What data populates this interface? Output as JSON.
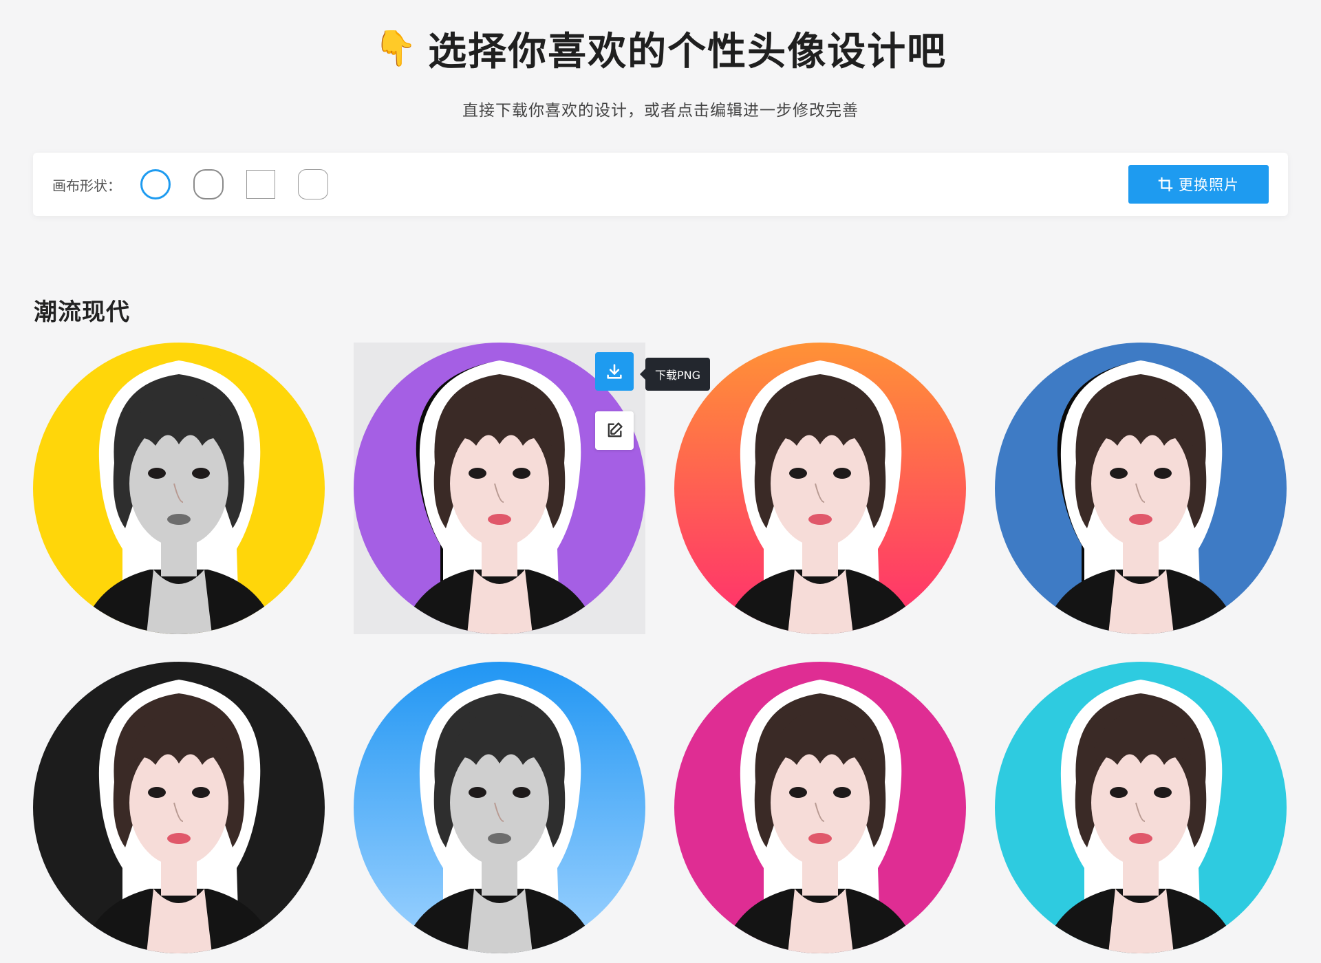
{
  "header": {
    "emoji": "👇",
    "title": "选择你喜欢的个性头像设计吧",
    "subtitle": "直接下载你喜欢的设计，或者点击编辑进一步修改完善"
  },
  "toolbar": {
    "shape_label": "画布形状：",
    "shapes": [
      "circle",
      "rounded-circle",
      "square",
      "rounded-square"
    ],
    "active_shape": "circle",
    "swap_button_label": "更换照片",
    "accent_color": "#1e9bf0"
  },
  "section": {
    "title": "潮流现代"
  },
  "designs": [
    {
      "bg_top": "#ffd60a",
      "bg_bottom": "#ffd60a",
      "grayscale": true,
      "black_outline": false
    },
    {
      "bg_top": "#a55fe4",
      "bg_bottom": "#a55fe4",
      "grayscale": false,
      "black_outline": true
    },
    {
      "bg_top": "#ff9236",
      "bg_bottom": "#ff2d6f",
      "grayscale": false,
      "black_outline": false
    },
    {
      "bg_top": "#3e7bc5",
      "bg_bottom": "#3e7bc5",
      "grayscale": false,
      "black_outline": true
    },
    {
      "bg_top": "#1c1c1c",
      "bg_bottom": "#1c1c1c",
      "grayscale": false,
      "black_outline": false
    },
    {
      "bg_top": "#2196f3",
      "bg_bottom": "#9fd3ff",
      "grayscale": true,
      "black_outline": false
    },
    {
      "bg_top": "#df2d93",
      "bg_bottom": "#df2d93",
      "grayscale": false,
      "black_outline": false
    },
    {
      "bg_top": "#2ecbe0",
      "bg_bottom": "#2ecbe0",
      "grayscale": false,
      "black_outline": false
    }
  ],
  "hover": {
    "card_index": 1,
    "download_tooltip": "下载PNG",
    "download_icon": "download-icon",
    "edit_icon": "edit-icon"
  }
}
